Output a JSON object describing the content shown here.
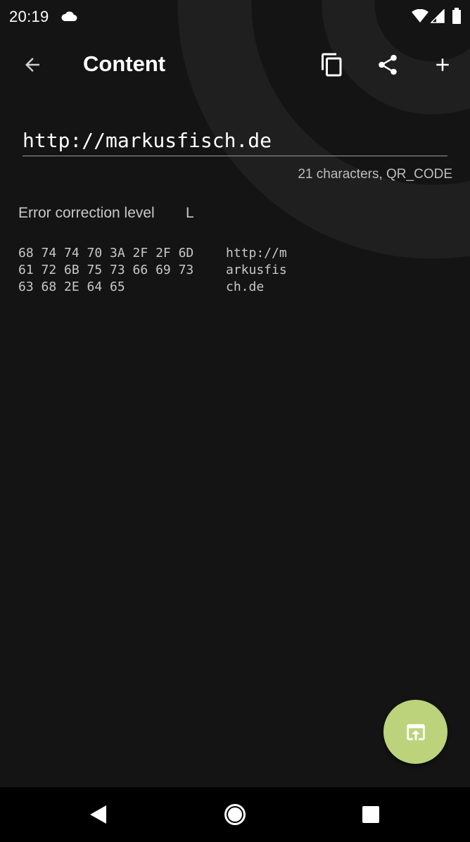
{
  "status_bar": {
    "time": "20:19",
    "icons": [
      "cloud-icon",
      "wifi-icon",
      "signal-icon",
      "battery-icon"
    ]
  },
  "toolbar": {
    "back_icon": "arrow-left-icon",
    "title": "Content",
    "actions": [
      "copy-icon",
      "share-icon",
      "plus-icon"
    ]
  },
  "content": {
    "value": "http://markusfisch.de",
    "meta": "21 characters, QR_CODE"
  },
  "error_correction": {
    "label": "Error correction level",
    "value": "L"
  },
  "hex_dump": [
    {
      "bytes": "68 74 74 70 3A 2F 2F 6D",
      "ascii": "http://m"
    },
    {
      "bytes": "61 72 6B 75 73 66 69 73",
      "ascii": "arkusfis"
    },
    {
      "bytes": "63 68 2E 64 65",
      "ascii": "ch.de"
    }
  ],
  "fab": {
    "icon": "open-in-app-icon"
  },
  "nav_bar": {
    "icons": [
      "nav-back-triangle-icon",
      "nav-home-circle-icon",
      "nav-recents-square-icon"
    ]
  },
  "colors": {
    "background": "#141414",
    "fab": "#bcd37c",
    "nav_bar": "#000000",
    "text_primary": "#ffffff",
    "text_secondary": "#c8c8c8"
  }
}
